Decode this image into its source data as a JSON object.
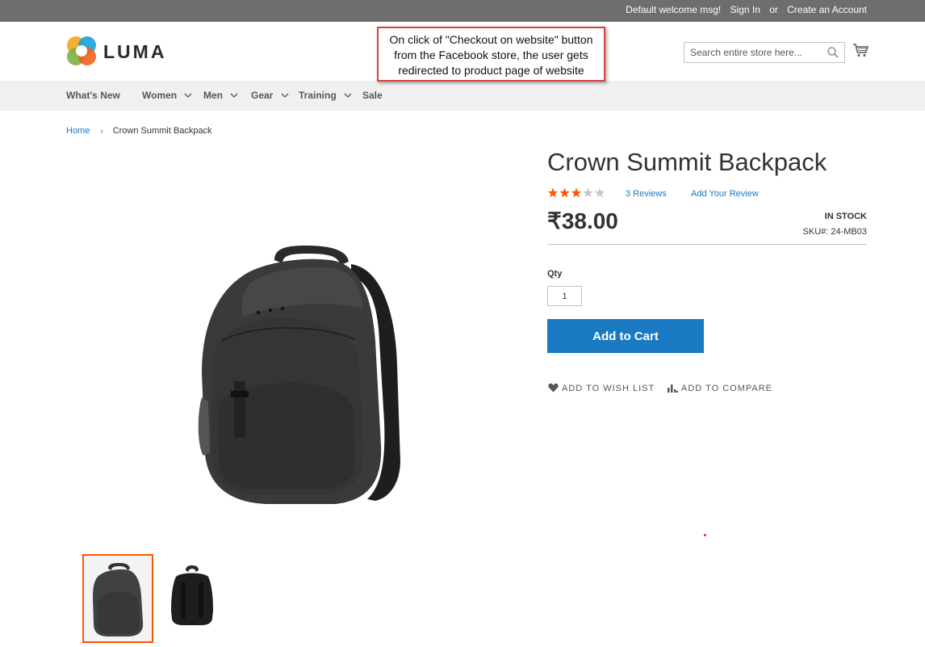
{
  "topbar": {
    "welcome": "Default welcome msg!",
    "sign_in": "Sign In",
    "or": "or",
    "create_account": "Create an Account"
  },
  "header": {
    "logo_text": "LUMA",
    "search_placeholder": "Search entire store here..."
  },
  "callout": {
    "text": "On click of \"Checkout on website\" button from the Facebook store, the user gets redirected to product  page of website"
  },
  "nav": {
    "items": [
      {
        "label": "What's New",
        "has_dropdown": false
      },
      {
        "label": "Women",
        "has_dropdown": true
      },
      {
        "label": "Men",
        "has_dropdown": true
      },
      {
        "label": "Gear",
        "has_dropdown": true
      },
      {
        "label": "Training",
        "has_dropdown": true
      },
      {
        "label": "Sale",
        "has_dropdown": false
      }
    ]
  },
  "breadcrumb": {
    "home": "Home",
    "current": "Crown Summit Backpack"
  },
  "product": {
    "name": "Crown Summit Backpack",
    "rating_stars": 3,
    "rating_max": 5,
    "reviews_label": "3  Reviews",
    "add_review": "Add Your Review",
    "price": "₹38.00",
    "stock": "IN STOCK",
    "sku": "SKU#:  24-MB03",
    "qty_label": "Qty",
    "qty_value": "1",
    "add_to_cart": "Add to Cart",
    "wish_list": "ADD TO WISH LIST",
    "compare": "ADD TO COMPARE"
  },
  "colors": {
    "topbar": "#6e6e6e",
    "nav_bg": "#f0f0f0",
    "primary_button": "#1979c3",
    "link": "#1979c3",
    "star_on": "#ff5501",
    "star_off": "#c7c7c7",
    "thumb_active_border": "#ff5501",
    "callout_border": "#d94040"
  },
  "icons": [
    "luma-logo-icon",
    "search-icon",
    "cart-icon",
    "chevron-down-icon",
    "star-icon",
    "heart-icon",
    "compare-icon"
  ]
}
